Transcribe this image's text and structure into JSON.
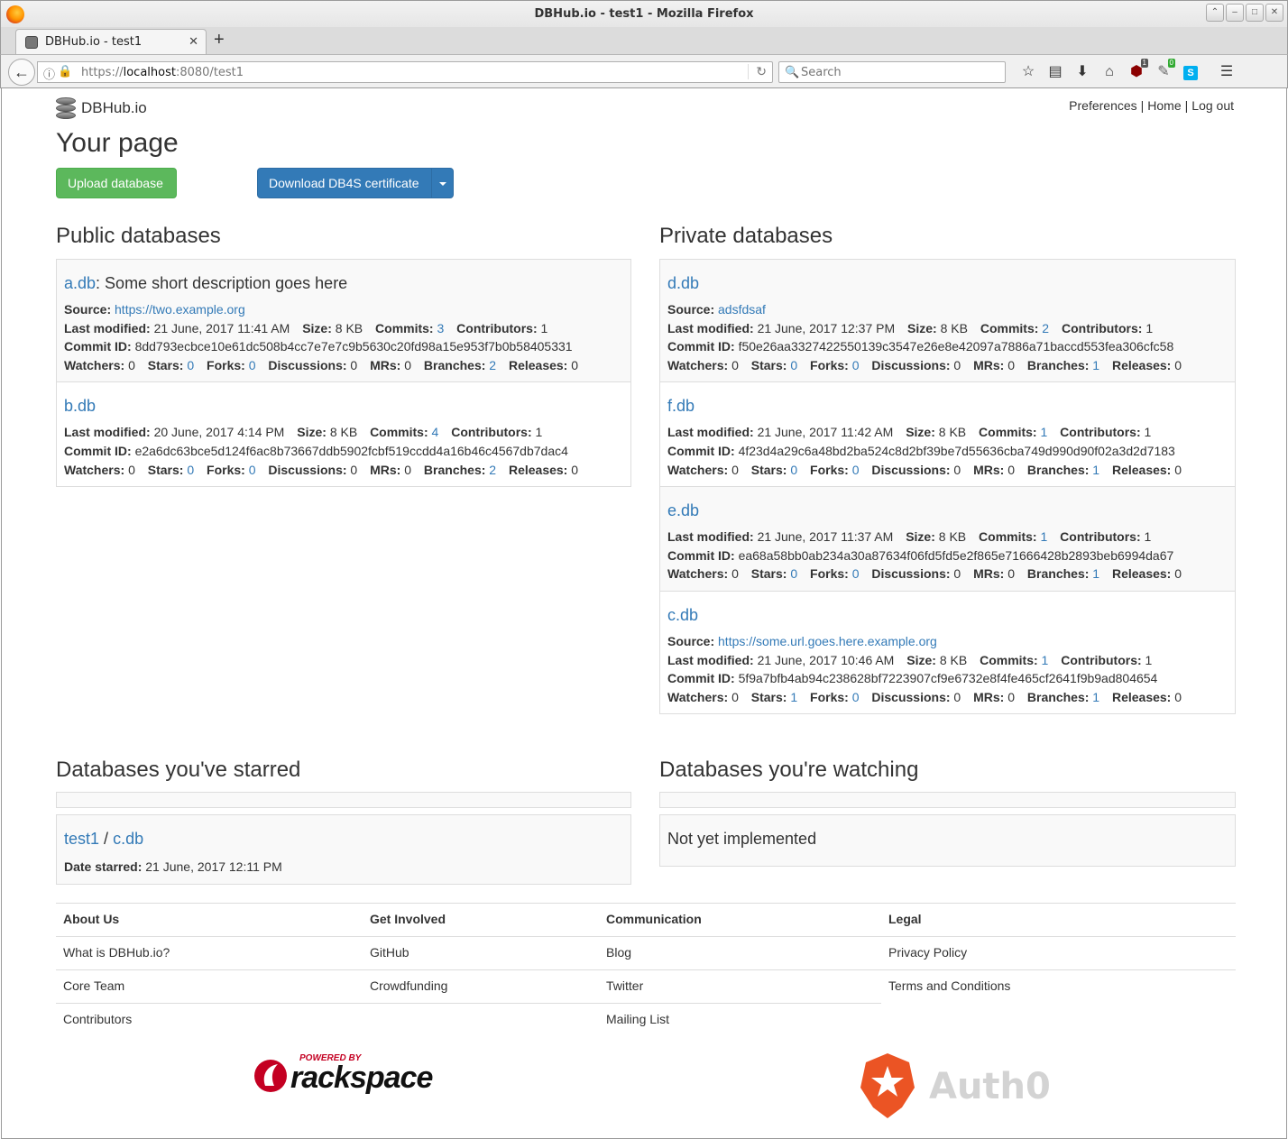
{
  "browser": {
    "window_title": "DBHub.io - test1 - Mozilla Firefox",
    "tab_title": "DBHub.io - test1",
    "url_scheme": "https://",
    "url_host": "localhost",
    "url_rest": ":8080/test1",
    "search_placeholder": "Search",
    "badge_ublock": "1",
    "badge_green": "0"
  },
  "header": {
    "brand": "DBHub.io",
    "links": [
      "Preferences",
      "Home",
      "Log out"
    ],
    "separator": "|"
  },
  "page_title": "Your page",
  "buttons": {
    "upload": "Upload database",
    "download": "Download DB4S certificate"
  },
  "public": {
    "heading": "Public databases",
    "entries": [
      {
        "name": "a.db",
        "description": ": Some short description goes here",
        "source": "https://two.example.org",
        "last_modified": "21 June, 2017 11:41 AM",
        "size": "8 KB",
        "commits": "3",
        "contributors": "1",
        "commit_id": "8dd793ecbce10e61dc508b4cc7e7e7c9b5630c20fd98a15e953f7b0b58405331",
        "watchers": "0",
        "stars": "0",
        "forks": "0",
        "discussions": "0",
        "mrs": "0",
        "branches": "2",
        "releases": "0"
      },
      {
        "name": "b.db",
        "description": "",
        "source": "",
        "last_modified": "20 June, 2017 4:14 PM",
        "size": "8 KB",
        "commits": "4",
        "contributors": "1",
        "commit_id": "e2a6dc63bce5d124f6ac8b73667ddb5902fcbf519ccdd4a16b46c4567db7dac4",
        "watchers": "0",
        "stars": "0",
        "forks": "0",
        "discussions": "0",
        "mrs": "0",
        "branches": "2",
        "releases": "0"
      }
    ]
  },
  "private": {
    "heading": "Private databases",
    "entries": [
      {
        "name": "d.db",
        "description": "",
        "source": "adsfdsaf",
        "last_modified": "21 June, 2017 12:37 PM",
        "size": "8 KB",
        "commits": "2",
        "contributors": "1",
        "commit_id": "f50e26aa3327422550139c3547e26e8e42097a7886a71baccd553fea306cfc58",
        "watchers": "0",
        "stars": "0",
        "forks": "0",
        "discussions": "0",
        "mrs": "0",
        "branches": "1",
        "releases": "0"
      },
      {
        "name": "f.db",
        "description": "",
        "source": "",
        "last_modified": "21 June, 2017 11:42 AM",
        "size": "8 KB",
        "commits": "1",
        "contributors": "1",
        "commit_id": "4f23d4a29c6a48bd2ba524c8d2bf39be7d55636cba749d990d90f02a3d2d7183",
        "watchers": "0",
        "stars": "0",
        "forks": "0",
        "discussions": "0",
        "mrs": "0",
        "branches": "1",
        "releases": "0"
      },
      {
        "name": "e.db",
        "description": "",
        "source": "",
        "last_modified": "21 June, 2017 11:37 AM",
        "size": "8 KB",
        "commits": "1",
        "contributors": "1",
        "commit_id": "ea68a58bb0ab234a30a87634f06fd5fd5e2f865e71666428b2893beb6994da67",
        "watchers": "0",
        "stars": "0",
        "forks": "0",
        "discussions": "0",
        "mrs": "0",
        "branches": "1",
        "releases": "0"
      },
      {
        "name": "c.db",
        "description": "",
        "source": "https://some.url.goes.here.example.org",
        "last_modified": "21 June, 2017 10:46 AM",
        "size": "8 KB",
        "commits": "1",
        "contributors": "1",
        "commit_id": "5f9a7bfb4ab94c238628bf7223907cf9e6732e8f4fe465cf2641f9b9ad804654",
        "watchers": "0",
        "stars": "1",
        "forks": "0",
        "discussions": "0",
        "mrs": "0",
        "branches": "1",
        "releases": "0"
      }
    ]
  },
  "labels": {
    "source": "Source:",
    "last_modified": "Last modified:",
    "size": "Size:",
    "commits": "Commits:",
    "contributors": "Contributors:",
    "commit_id": "Commit ID:",
    "watchers": "Watchers:",
    "stars": "Stars:",
    "forks": "Forks:",
    "discussions": "Discussions:",
    "mrs": "MRs:",
    "branches": "Branches:",
    "releases": "Releases:",
    "date_starred": "Date starred:"
  },
  "starred": {
    "heading": "Databases you've starred",
    "owner": "test1",
    "slash": "/",
    "name": "c.db",
    "date_starred": "21 June, 2017 12:11 PM"
  },
  "watching": {
    "heading": "Databases you're watching",
    "message": "Not yet implemented"
  },
  "footer": {
    "columns": [
      {
        "head": "About Us",
        "items": [
          {
            "text": "What is DBHub.io?",
            "link": true
          },
          {
            "text": "Core Team",
            "link": false
          },
          {
            "text": "Contributors",
            "link": false
          }
        ]
      },
      {
        "head": "Get Involved",
        "items": [
          {
            "text": "GitHub",
            "link": true
          },
          {
            "text": "Crowdfunding",
            "link": false
          }
        ]
      },
      {
        "head": "Communication",
        "items": [
          {
            "text": "Blog",
            "link": false
          },
          {
            "text": "Twitter",
            "link": true
          },
          {
            "text": "Mailing List",
            "link": true
          }
        ]
      },
      {
        "head": "Legal",
        "items": [
          {
            "text": "Privacy Policy",
            "link": false
          },
          {
            "text": "Terms and Conditions",
            "link": false
          }
        ]
      }
    ],
    "rackspace_small": "POWERED BY",
    "rackspace_big": "rackspace",
    "auth0": "Auth0"
  },
  "colors": {
    "link": "#337ab7",
    "success": "#5cb85c",
    "primary": "#337ab7",
    "rackspace_red": "#c40022",
    "auth0_orange": "#eb5424"
  }
}
